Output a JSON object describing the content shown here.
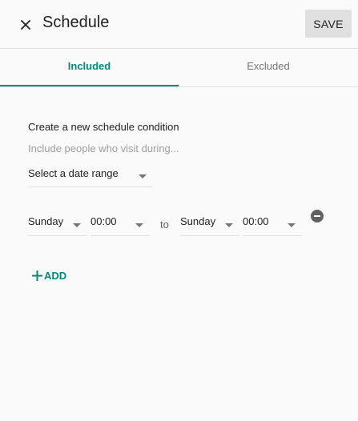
{
  "header": {
    "title": "Schedule",
    "save_label": "SAVE",
    "close_icon": "close-icon"
  },
  "tabs": [
    {
      "label": "Included",
      "active": true
    },
    {
      "label": "Excluded",
      "active": false
    }
  ],
  "condition": {
    "title": "Create a new schedule condition",
    "hint": "Include people who visit during...",
    "date_range": {
      "value": "Select a date range"
    },
    "row": {
      "from_day": "Sunday",
      "from_time": "00:00",
      "to_label": "to",
      "to_day": "Sunday",
      "to_time": "00:00",
      "remove_icon": "remove-circle-icon"
    }
  },
  "add": {
    "label": "ADD",
    "icon": "plus-icon"
  },
  "colors": {
    "accent": "#00897b",
    "background": "#fafafa",
    "save_button_bg": "#e0e0e0",
    "divider": "#e0e0e0",
    "muted_text": "#9e9e9e"
  }
}
